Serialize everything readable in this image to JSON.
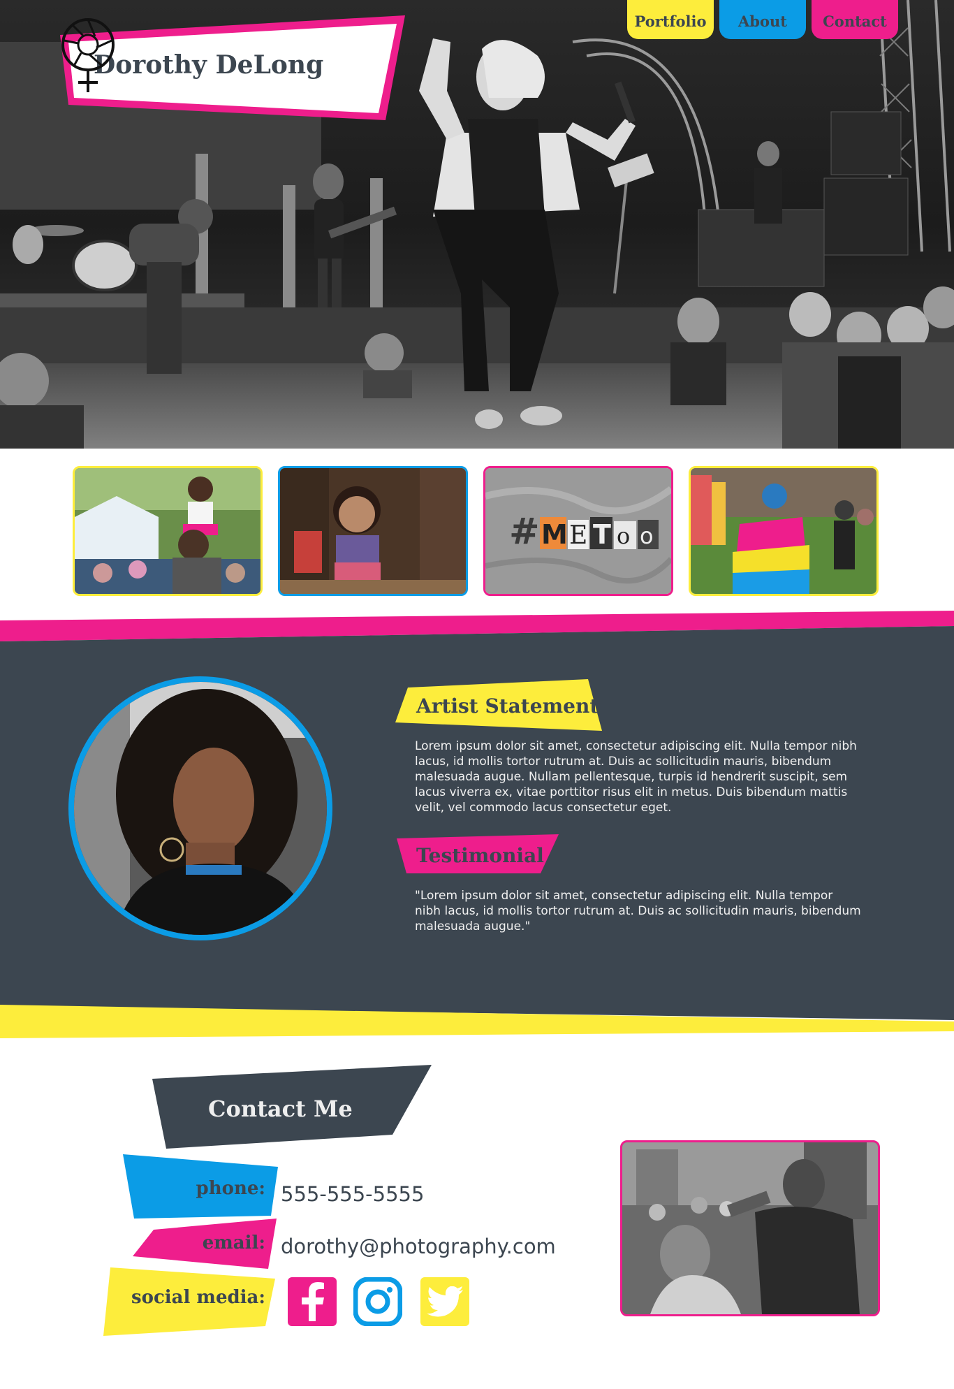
{
  "brand": {
    "name": "Dorothy DeLong",
    "logo_icon": "aperture-female-symbol-icon"
  },
  "nav": {
    "items": [
      {
        "label": "Portfolio",
        "color": "#fded3c"
      },
      {
        "label": "About",
        "color": "#0b9ce6"
      },
      {
        "label": "Contact",
        "color": "#ee1e8c"
      }
    ]
  },
  "gallery": {
    "thumbnails": [
      {
        "subject": "father-daughter-festival",
        "border": "#fded3c"
      },
      {
        "subject": "smiling-girl",
        "border": "#0b9ce6"
      },
      {
        "subject": "metoo-letters",
        "border": "#ee1e8c",
        "text": "#METoo"
      },
      {
        "subject": "pride-flag-crowd",
        "border": "#fded3c"
      }
    ]
  },
  "about": {
    "statement_heading": "Artist Statement",
    "statement_text": "Lorem ipsum dolor sit amet, consectetur adipiscing elit. Nulla tempor nibh lacus, id mollis tortor rutrum at. Duis ac sollicitudin mauris, bibendum malesuada augue. Nullam pellentesque, turpis id hendrerit suscipit, sem lacus viverra ex, vitae porttitor risus elit in metus. Duis bibendum mattis velit, vel commodo lacus consectetur eget.",
    "testimonial_heading": "Testimonial",
    "testimonial_text": "\"Lorem ipsum dolor sit amet, consectetur adipiscing elit. Nulla tempor nibh lacus, id mollis tortor rutrum at. Duis ac sollicitudin mauris, bibendum malesuada augue.\""
  },
  "contact": {
    "heading": "Contact Me",
    "phone_label": "phone:",
    "phone_value": "555-555-5555",
    "email_label": "email:",
    "email_value": "dorothy@photography.com",
    "social_label": "social media:",
    "social": [
      {
        "name": "facebook-icon",
        "color": "#ee1e8c"
      },
      {
        "name": "instagram-icon",
        "color": "#0b9ce6"
      },
      {
        "name": "twitter-icon",
        "color": "#fded3c"
      }
    ]
  },
  "colors": {
    "yellow": "#fded3c",
    "blue": "#0b9ce6",
    "pink": "#ee1e8c",
    "slate": "#3c4650"
  }
}
